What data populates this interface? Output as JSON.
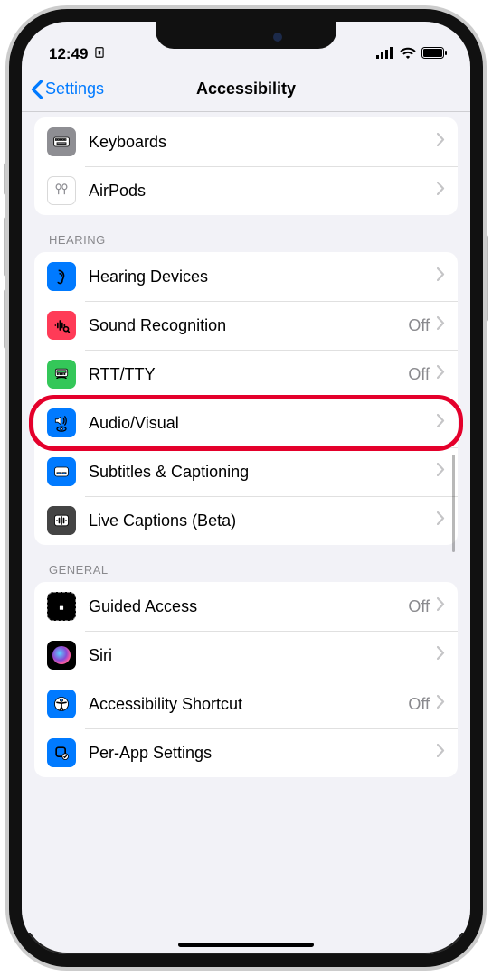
{
  "status": {
    "time": "12:49",
    "orientation_lock": true
  },
  "nav": {
    "back_label": "Settings",
    "title": "Accessibility"
  },
  "sections": {
    "top_items": [
      {
        "id": "keyboards",
        "label": "Keyboards",
        "icon": "keyboard-icon",
        "bg": "ic-gray"
      },
      {
        "id": "airpods",
        "label": "AirPods",
        "icon": "airpods-icon",
        "bg": "ic-white"
      }
    ],
    "hearing_header": "Hearing",
    "hearing_items": [
      {
        "id": "hearing-devices",
        "label": "Hearing Devices",
        "icon": "ear-icon",
        "bg": "ic-blue",
        "value": null
      },
      {
        "id": "sound-recognition",
        "label": "Sound Recognition",
        "icon": "waveform-icon",
        "bg": "ic-red",
        "value": "Off"
      },
      {
        "id": "rtt-tty",
        "label": "RTT/TTY",
        "icon": "tty-icon",
        "bg": "ic-green",
        "value": "Off"
      },
      {
        "id": "audio-visual",
        "label": "Audio/Visual",
        "icon": "speaker-eye-icon",
        "bg": "ic-blue",
        "value": null,
        "highlight": true
      },
      {
        "id": "subtitles",
        "label": "Subtitles & Captioning",
        "icon": "caption-icon",
        "bg": "ic-blue",
        "value": null
      },
      {
        "id": "live-captions",
        "label": "Live Captions (Beta)",
        "icon": "live-caption-icon",
        "bg": "ic-dark",
        "value": null
      }
    ],
    "general_header": "General",
    "general_items": [
      {
        "id": "guided-access",
        "label": "Guided Access",
        "icon": "lock-frame-icon",
        "bg": "ic-black",
        "value": "Off"
      },
      {
        "id": "siri",
        "label": "Siri",
        "icon": "siri-icon",
        "bg": "ic-grad",
        "value": null
      },
      {
        "id": "accessibility-shortcut",
        "label": "Accessibility Shortcut",
        "icon": "accessibility-icon",
        "bg": "ic-blue",
        "value": "Off"
      },
      {
        "id": "per-app",
        "label": "Per-App Settings",
        "icon": "app-check-icon",
        "bg": "ic-blue",
        "value": null
      }
    ]
  }
}
